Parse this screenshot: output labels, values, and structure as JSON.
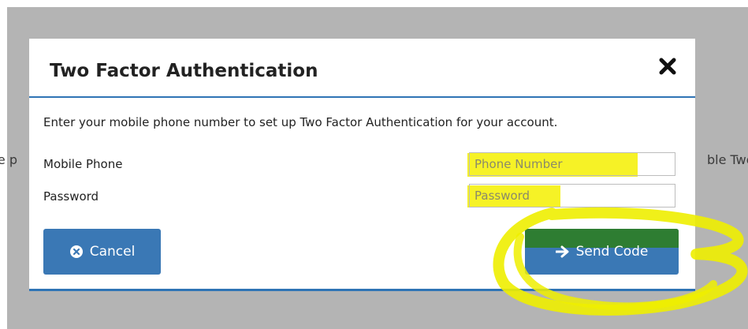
{
  "background": {
    "left_fragment": "le p",
    "right_fragment": "ble Two"
  },
  "dialog": {
    "title": "Two Factor Authentication",
    "close_icon": "close-x-icon",
    "intro": "Enter your mobile phone number to set up Two Factor Authentication for your account.",
    "fields": {
      "phone": {
        "label": "Mobile Phone",
        "placeholder": "Phone Number",
        "value": ""
      },
      "password": {
        "label": "Password",
        "placeholder": "Password",
        "value": ""
      }
    },
    "buttons": {
      "cancel": {
        "label": "Cancel",
        "icon": "circle-x-icon"
      },
      "send": {
        "label": "Send Code",
        "icon": "arrow-right-icon"
      }
    }
  },
  "colors": {
    "primary": "#3a78b5",
    "header_border": "#2f74b5",
    "highlight": "#f4f000",
    "overlay": "#b4b4b4",
    "send_top": "#2e7d32"
  }
}
